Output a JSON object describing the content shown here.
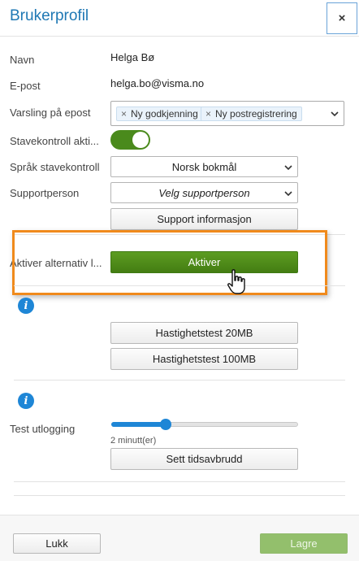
{
  "header": {
    "title": "Brukerprofil",
    "close_label": "×"
  },
  "fields": {
    "name_label": "Navn",
    "name_value": "Helga Bø",
    "email_label": "E-post",
    "email_value": "helga.bo@visma.no",
    "notify_label": "Varsling på epost",
    "notify_chips": [
      "Ny godkjenning",
      "Ny postregistrering"
    ],
    "chip_remove": "×",
    "spellcheck_label": "Stavekontroll akti...",
    "spellcheck_on": true,
    "spellcheck_lang_label": "Språk stavekontroll",
    "spellcheck_lang_value": "Norsk bokmål",
    "support_label": "Supportperson",
    "support_placeholder": "Velg supportperson",
    "support_info_button": "Support informasjon",
    "alt_label": "Aktiver alternativ l...",
    "alt_button": "Aktiver",
    "speed_20": "Hastighetstest 20MB",
    "speed_100": "Hastighetstest 100MB",
    "info_icon": "i",
    "logout_label": "Test utlogging",
    "logout_slider_value": "2 minutt(er)",
    "logout_slider_fraction": 0.29,
    "timeout_button": "Sett tidsavbrudd"
  },
  "footer": {
    "close_button": "Lukk",
    "save_button": "Lagre"
  },
  "colors": {
    "accent": "#1f78b4",
    "green": "#4a8a1c",
    "highlight": "#f08a1c",
    "info": "#1e86d6"
  }
}
